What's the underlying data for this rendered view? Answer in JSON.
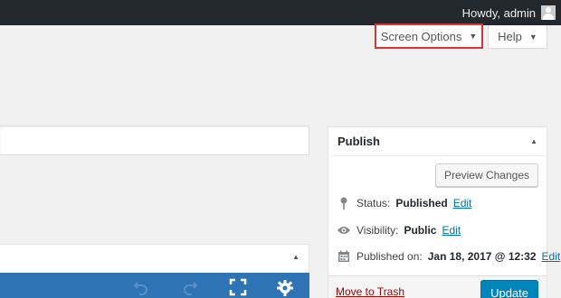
{
  "admin_bar": {
    "greeting": "Howdy, admin"
  },
  "screen_meta": {
    "screen_options_label": "Screen Options",
    "help_label": "Help",
    "toggle_glyph": "▼"
  },
  "editor": {
    "collapse_glyph": "▲",
    "toolbar_icons": [
      "undo-icon",
      "redo-icon",
      "fullscreen-icon",
      "settings-gear-icon"
    ],
    "toolbar_color": "#2e74b5"
  },
  "publish_box": {
    "title": "Publish",
    "collapse_glyph": "▲",
    "preview_label": "Preview Changes",
    "status_label": "Status:",
    "status_value": "Published",
    "visibility_label": "Visibility:",
    "visibility_value": "Public",
    "published_label": "Published on:",
    "published_value": "Jan 18, 2017 @ 12:32",
    "edit_label": "Edit",
    "trash_label": "Move to Trash",
    "update_label": "Update",
    "icons": [
      "pin-icon",
      "eye-icon",
      "calendar-icon"
    ],
    "accent_color": "#0085ba",
    "trash_color": "#a00"
  }
}
